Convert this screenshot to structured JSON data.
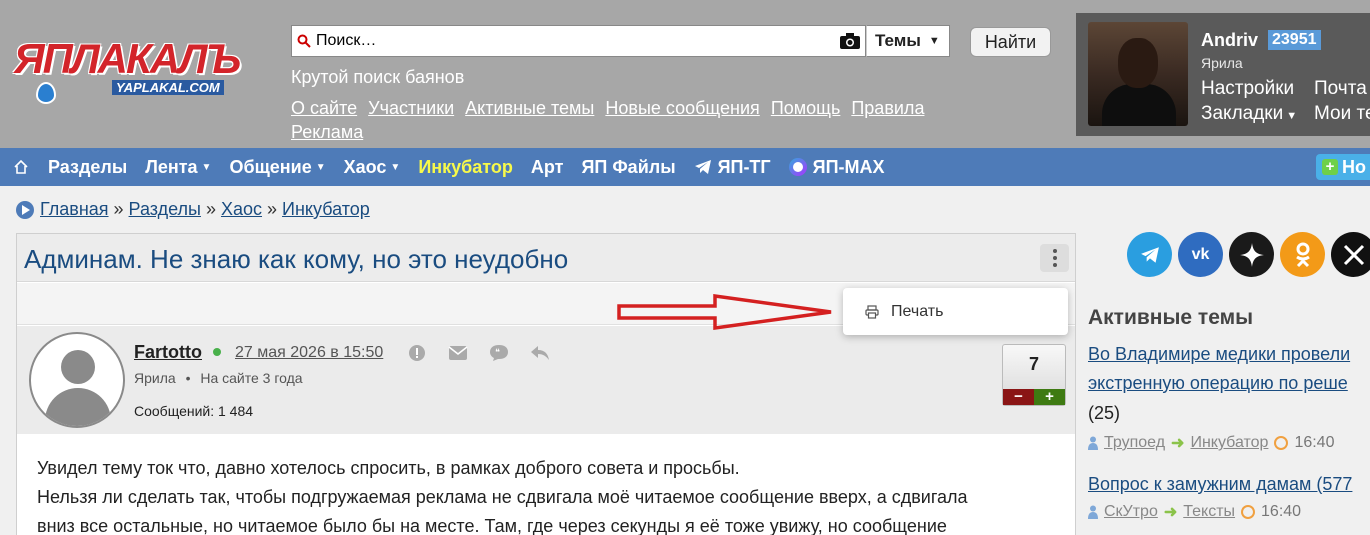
{
  "logo": {
    "main": "ЯПЛАКАЛЪ",
    "sub": "YAPLAKAL.COM"
  },
  "search": {
    "placeholder": "Поиск…",
    "select": "Темы",
    "button": "Найти"
  },
  "slogan": "Крутой поиск баянов",
  "top_links": [
    "О сайте",
    "Участники",
    "Активные темы",
    "Новые сообщения",
    "Помощь",
    "Правила",
    "Реклама"
  ],
  "user": {
    "name": "Andriv",
    "count": "23951",
    "rank": "Ярила",
    "menu": [
      "Настройки",
      "Закладки"
    ],
    "menu2": [
      "Почта",
      "Мои те"
    ]
  },
  "nav": {
    "items": [
      {
        "label": "Разделы"
      },
      {
        "label": "Лента"
      },
      {
        "label": "Общение"
      },
      {
        "label": "Хаос"
      },
      {
        "label": "Инкубатор"
      },
      {
        "label": "Арт"
      },
      {
        "label": "ЯП Файлы"
      },
      {
        "label": "ЯП-ТГ"
      },
      {
        "label": "ЯП-MAX"
      }
    ],
    "new_label": "Но"
  },
  "breadcrumb": [
    "Главная",
    "Разделы",
    "Хаос",
    "Инкубатор"
  ],
  "topic": {
    "title": "Админам. Не знаю как кому, но это неудобно"
  },
  "dropdown": {
    "print": "Печать"
  },
  "post": {
    "author": "Fartotto",
    "date": "27 мая 2026 в 15:50",
    "rank": "Ярила",
    "tenure": "На сайте 3 года",
    "messages": "Сообщений: 1 484",
    "rating": "7",
    "body": [
      "Увидел тему ток что, давно хотелось спросить, в рамках доброго совета и просьбы.",
      "Нельзя ли сделать так, чтобы подгружаемая реклама не сдвигала моё читаемое сообщение вверх, а сдвигала",
      "вниз все остальные, но читаемое было бы на месте. Там, где через секунды я её тоже увижу, но сообщение"
    ]
  },
  "sidebar": {
    "active_title": "Активные темы",
    "topics": [
      {
        "line1": "Во Владимире медики провели",
        "line2": "экстренную операцию по реше",
        "count": "(25)",
        "user": "Трупоед",
        "section": "Инкубатор",
        "time": "16:40"
      },
      {
        "line1": "Вопрос к замужним дамам (577",
        "user": "СкУтро",
        "section": "Тексты",
        "time": "16:40"
      }
    ]
  },
  "colors": {
    "header_bg": "#a7a7a7",
    "nav_bg": "#4e7bb8",
    "link": "#1a4c80",
    "arrow": "#d42020"
  }
}
